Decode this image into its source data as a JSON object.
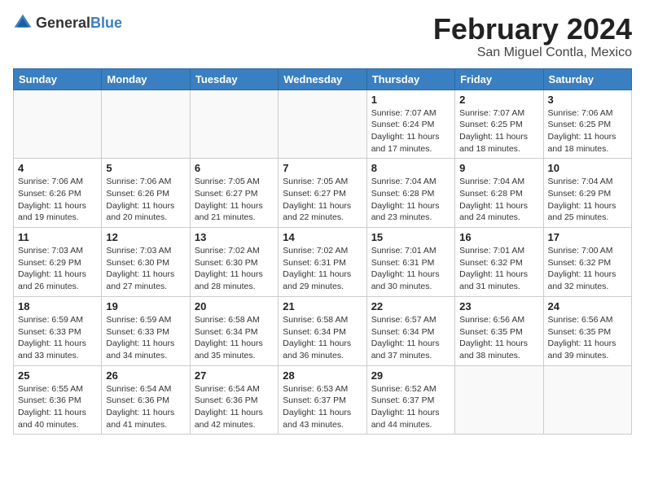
{
  "header": {
    "logo_general": "General",
    "logo_blue": "Blue",
    "month_title": "February 2024",
    "location": "San Miguel Contla, Mexico"
  },
  "weekdays": [
    "Sunday",
    "Monday",
    "Tuesday",
    "Wednesday",
    "Thursday",
    "Friday",
    "Saturday"
  ],
  "weeks": [
    [
      {
        "day": "",
        "info": ""
      },
      {
        "day": "",
        "info": ""
      },
      {
        "day": "",
        "info": ""
      },
      {
        "day": "",
        "info": ""
      },
      {
        "day": "1",
        "info": "Sunrise: 7:07 AM\nSunset: 6:24 PM\nDaylight: 11 hours and 17 minutes."
      },
      {
        "day": "2",
        "info": "Sunrise: 7:07 AM\nSunset: 6:25 PM\nDaylight: 11 hours and 18 minutes."
      },
      {
        "day": "3",
        "info": "Sunrise: 7:06 AM\nSunset: 6:25 PM\nDaylight: 11 hours and 18 minutes."
      }
    ],
    [
      {
        "day": "4",
        "info": "Sunrise: 7:06 AM\nSunset: 6:26 PM\nDaylight: 11 hours and 19 minutes."
      },
      {
        "day": "5",
        "info": "Sunrise: 7:06 AM\nSunset: 6:26 PM\nDaylight: 11 hours and 20 minutes."
      },
      {
        "day": "6",
        "info": "Sunrise: 7:05 AM\nSunset: 6:27 PM\nDaylight: 11 hours and 21 minutes."
      },
      {
        "day": "7",
        "info": "Sunrise: 7:05 AM\nSunset: 6:27 PM\nDaylight: 11 hours and 22 minutes."
      },
      {
        "day": "8",
        "info": "Sunrise: 7:04 AM\nSunset: 6:28 PM\nDaylight: 11 hours and 23 minutes."
      },
      {
        "day": "9",
        "info": "Sunrise: 7:04 AM\nSunset: 6:28 PM\nDaylight: 11 hours and 24 minutes."
      },
      {
        "day": "10",
        "info": "Sunrise: 7:04 AM\nSunset: 6:29 PM\nDaylight: 11 hours and 25 minutes."
      }
    ],
    [
      {
        "day": "11",
        "info": "Sunrise: 7:03 AM\nSunset: 6:29 PM\nDaylight: 11 hours and 26 minutes."
      },
      {
        "day": "12",
        "info": "Sunrise: 7:03 AM\nSunset: 6:30 PM\nDaylight: 11 hours and 27 minutes."
      },
      {
        "day": "13",
        "info": "Sunrise: 7:02 AM\nSunset: 6:30 PM\nDaylight: 11 hours and 28 minutes."
      },
      {
        "day": "14",
        "info": "Sunrise: 7:02 AM\nSunset: 6:31 PM\nDaylight: 11 hours and 29 minutes."
      },
      {
        "day": "15",
        "info": "Sunrise: 7:01 AM\nSunset: 6:31 PM\nDaylight: 11 hours and 30 minutes."
      },
      {
        "day": "16",
        "info": "Sunrise: 7:01 AM\nSunset: 6:32 PM\nDaylight: 11 hours and 31 minutes."
      },
      {
        "day": "17",
        "info": "Sunrise: 7:00 AM\nSunset: 6:32 PM\nDaylight: 11 hours and 32 minutes."
      }
    ],
    [
      {
        "day": "18",
        "info": "Sunrise: 6:59 AM\nSunset: 6:33 PM\nDaylight: 11 hours and 33 minutes."
      },
      {
        "day": "19",
        "info": "Sunrise: 6:59 AM\nSunset: 6:33 PM\nDaylight: 11 hours and 34 minutes."
      },
      {
        "day": "20",
        "info": "Sunrise: 6:58 AM\nSunset: 6:34 PM\nDaylight: 11 hours and 35 minutes."
      },
      {
        "day": "21",
        "info": "Sunrise: 6:58 AM\nSunset: 6:34 PM\nDaylight: 11 hours and 36 minutes."
      },
      {
        "day": "22",
        "info": "Sunrise: 6:57 AM\nSunset: 6:34 PM\nDaylight: 11 hours and 37 minutes."
      },
      {
        "day": "23",
        "info": "Sunrise: 6:56 AM\nSunset: 6:35 PM\nDaylight: 11 hours and 38 minutes."
      },
      {
        "day": "24",
        "info": "Sunrise: 6:56 AM\nSunset: 6:35 PM\nDaylight: 11 hours and 39 minutes."
      }
    ],
    [
      {
        "day": "25",
        "info": "Sunrise: 6:55 AM\nSunset: 6:36 PM\nDaylight: 11 hours and 40 minutes."
      },
      {
        "day": "26",
        "info": "Sunrise: 6:54 AM\nSunset: 6:36 PM\nDaylight: 11 hours and 41 minutes."
      },
      {
        "day": "27",
        "info": "Sunrise: 6:54 AM\nSunset: 6:36 PM\nDaylight: 11 hours and 42 minutes."
      },
      {
        "day": "28",
        "info": "Sunrise: 6:53 AM\nSunset: 6:37 PM\nDaylight: 11 hours and 43 minutes."
      },
      {
        "day": "29",
        "info": "Sunrise: 6:52 AM\nSunset: 6:37 PM\nDaylight: 11 hours and 44 minutes."
      },
      {
        "day": "",
        "info": ""
      },
      {
        "day": "",
        "info": ""
      }
    ]
  ]
}
